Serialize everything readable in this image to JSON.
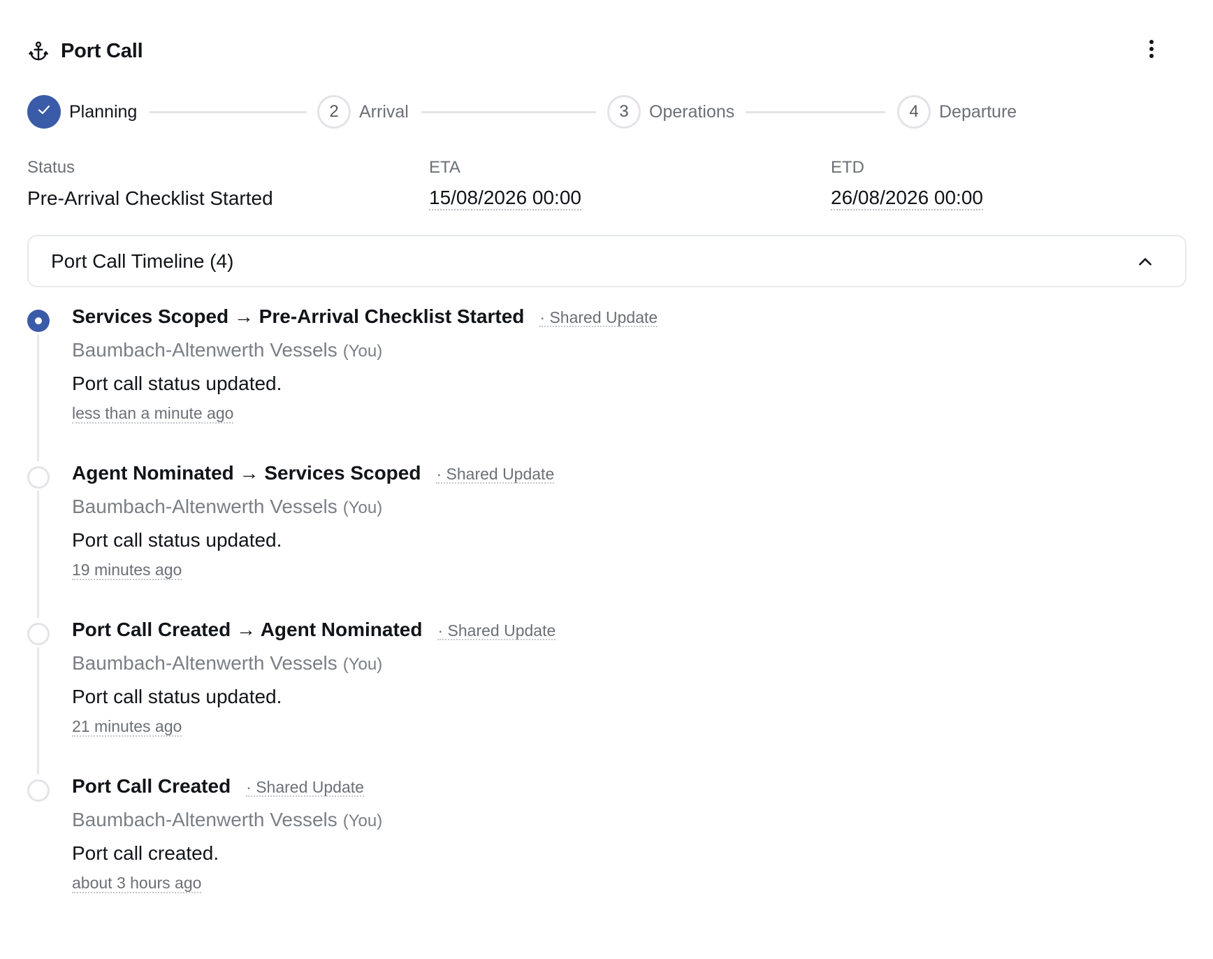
{
  "header": {
    "icon": "anchor-icon",
    "title": "Port Call",
    "menu_icon": "more-vertical-icon"
  },
  "stepper": {
    "steps": [
      {
        "number": "",
        "label": "Planning",
        "state": "completed"
      },
      {
        "number": "2",
        "label": "Arrival",
        "state": "upcoming"
      },
      {
        "number": "3",
        "label": "Operations",
        "state": "upcoming"
      },
      {
        "number": "4",
        "label": "Departure",
        "state": "upcoming"
      }
    ]
  },
  "details": {
    "status": {
      "label": "Status",
      "value": "Pre-Arrival Checklist Started"
    },
    "eta": {
      "label": "ETA",
      "value": "15/08/2026 00:00"
    },
    "etd": {
      "label": "ETD",
      "value": "26/08/2026 00:00"
    }
  },
  "timeline": {
    "title": "Port Call Timeline (4)",
    "expanded": true,
    "entries": [
      {
        "title": "Services Scoped → Pre-Arrival Checklist Started",
        "tag": "· Shared Update",
        "organization": "Baumbach-Altenwerth Vessels",
        "you": "(You)",
        "message": "Port call status updated.",
        "time": "less than a minute ago",
        "current": true
      },
      {
        "title": "Agent Nominated → Services Scoped",
        "tag": "· Shared Update",
        "organization": "Baumbach-Altenwerth Vessels",
        "you": "(You)",
        "message": "Port call status updated.",
        "time": "19 minutes ago",
        "current": false
      },
      {
        "title": "Port Call Created → Agent Nominated",
        "tag": "· Shared Update",
        "organization": "Baumbach-Altenwerth Vessels",
        "you": "(You)",
        "message": "Port call status updated.",
        "time": "21 minutes ago",
        "current": false
      },
      {
        "title": "Port Call Created",
        "tag": "· Shared Update",
        "organization": "Baumbach-Altenwerth Vessels",
        "you": "(You)",
        "message": "Port call created.",
        "time": "about 3 hours ago",
        "current": false
      }
    ]
  },
  "colors": {
    "accent": "#3a5ba8",
    "border": "#e6e8eb",
    "muted_text": "#6b7076"
  }
}
